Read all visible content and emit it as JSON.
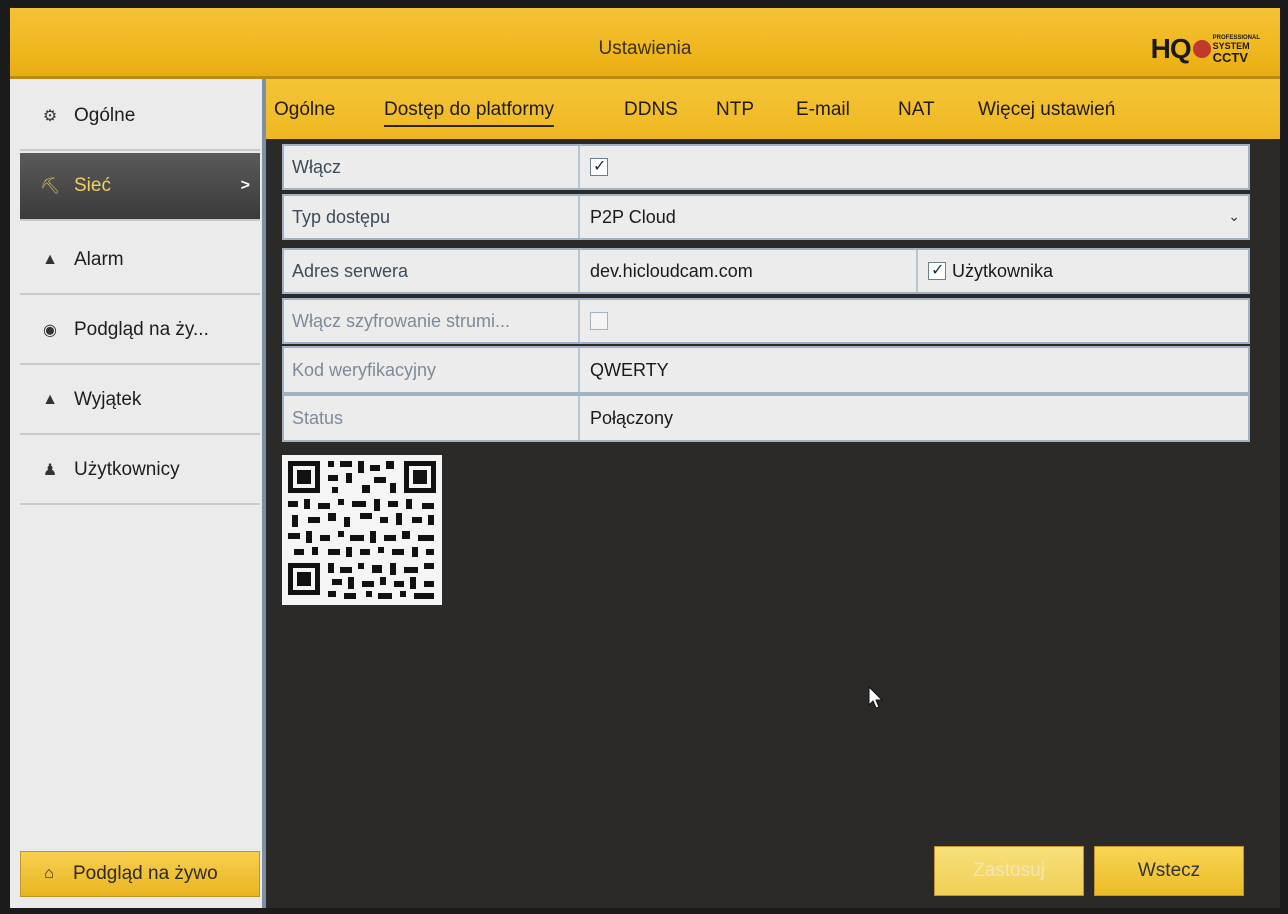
{
  "window": {
    "title": "Ustawienia",
    "logo": {
      "brand": "HQ",
      "line1": "PROFESSIONAL",
      "line2": "SYSTEM",
      "line3": "CCTV"
    }
  },
  "sidebar": {
    "items": [
      {
        "label": "Ogólne",
        "icon": "gear-icon"
      },
      {
        "label": "Sieć",
        "icon": "network-icon",
        "arrow": ">"
      },
      {
        "label": "Alarm",
        "icon": "alarm-icon"
      },
      {
        "label": "Podgląd na ży...",
        "icon": "eye-icon"
      },
      {
        "label": "Wyjątek",
        "icon": "warning-icon"
      },
      {
        "label": "Użytkownicy",
        "icon": "users-icon"
      }
    ],
    "live_button": {
      "label": "Podgląd na żywo",
      "icon": "home-icon"
    }
  },
  "tabs": [
    {
      "label": "Ogólne"
    },
    {
      "label": "Dostęp do platformy",
      "active": true
    },
    {
      "label": "DDNS"
    },
    {
      "label": "NTP"
    },
    {
      "label": "E-mail"
    },
    {
      "label": "NAT"
    },
    {
      "label": "Więcej ustawień"
    }
  ],
  "form": {
    "enable": {
      "label": "Włącz",
      "checked": true
    },
    "access_type": {
      "label": "Typ dostępu",
      "value": "P2P Cloud"
    },
    "server": {
      "label": "Adres serwera",
      "value": "dev.hicloudcam.com",
      "custom_label": "Użytkownika",
      "custom_checked": true
    },
    "encryption": {
      "label": "Włącz szyfrowanie strumi...",
      "checked": false
    },
    "verification": {
      "label": "Kod weryfikacyjny",
      "value": "QWERTY"
    },
    "status": {
      "label": "Status",
      "value": "Połączony"
    }
  },
  "buttons": {
    "apply": "Zastosuj",
    "back": "Wstecz"
  },
  "colors": {
    "accent": "#f0b81f",
    "sidebar_bg": "#ebebeb",
    "main_bg": "#2b2a28"
  }
}
